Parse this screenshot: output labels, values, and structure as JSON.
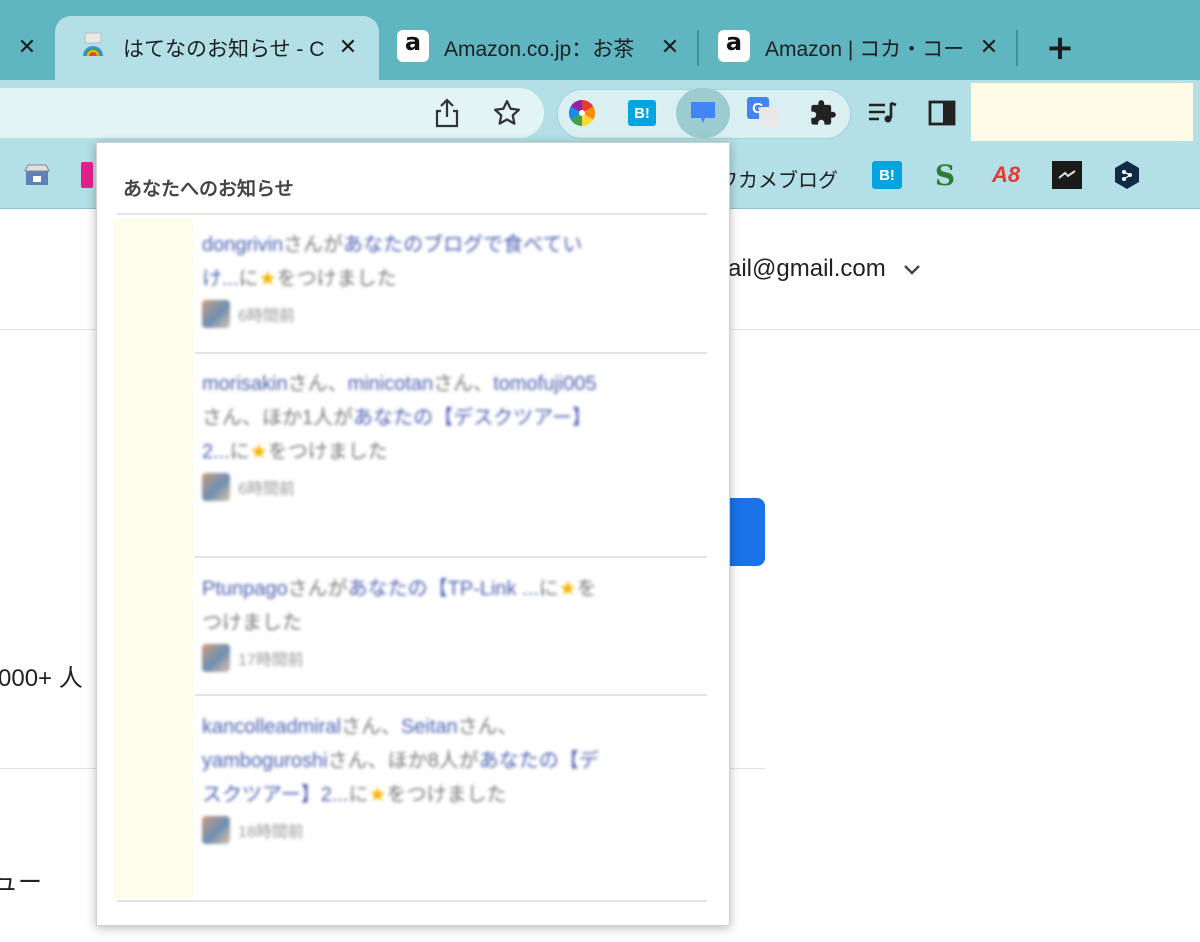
{
  "tabs": [
    {
      "title": "はてなのお知らせ - C",
      "active": true
    },
    {
      "title": "Amazon.co.jp：お茶",
      "active": false
    },
    {
      "title": "Amazon | コカ・コー",
      "active": false
    }
  ],
  "tab_close_glyph": "✕",
  "new_tab_glyph": "+",
  "toolbar": {
    "icons": [
      "share-icon",
      "bookmark-star-icon"
    ],
    "extensions": [
      "color-wheel-icon",
      "hatena-bookmark-icon",
      "notification-bubble-icon",
      "google-translate-icon",
      "puzzle-extensions-icon"
    ],
    "hatena_label": "B!",
    "translate_label": "G",
    "extra_icons": [
      "reading-list-icon",
      "side-panel-icon"
    ]
  },
  "bookmarks": {
    "visible_text": "ワカメブログ",
    "b_label": "B!",
    "s_label": "S",
    "a8_label": "A8"
  },
  "page": {
    "email": "ail@gmail.com",
    "count_text": "000+ 人",
    "menu_text": "ュー"
  },
  "popup": {
    "title": "あなたへのお知らせ",
    "notifications": [
      {
        "users": [
          "dongrivin"
        ],
        "prefix_join": "さんが",
        "link": "あなたのブログで食べていけ...",
        "suffix": "に",
        "star": "★",
        "action": "をつけました",
        "time": "6時間前"
      },
      {
        "users": [
          "morisakin",
          "minicotan",
          "tomofuji005"
        ],
        "prefix_join": "さんが",
        "others": "ほか1人が",
        "link": "あなたの【デスクツアー】2...",
        "suffix": "に",
        "star": "★",
        "action": "をつけました",
        "time": "6時間前"
      },
      {
        "users": [
          "Ptunpago"
        ],
        "prefix_join": "さんが",
        "link": "あなたの【TP-Link ...",
        "suffix": "に",
        "star": "★",
        "action": "をつけました",
        "time": "17時間前"
      },
      {
        "users": [
          "kancolleadmiral",
          "Seitan",
          "yamboguroshi"
        ],
        "prefix_join": "さんが",
        "others": "ほか8人が",
        "link": "あなたの【デスクツアー】2...",
        "suffix": "に",
        "star": "★",
        "action": "をつけました",
        "time": "18時間前"
      }
    ]
  },
  "colors": {
    "tabstrip": "#5fb6c0",
    "toolbar": "#b3e0e6",
    "accent_blue": "#1a73e8",
    "user_link": "#4a5fb0"
  }
}
